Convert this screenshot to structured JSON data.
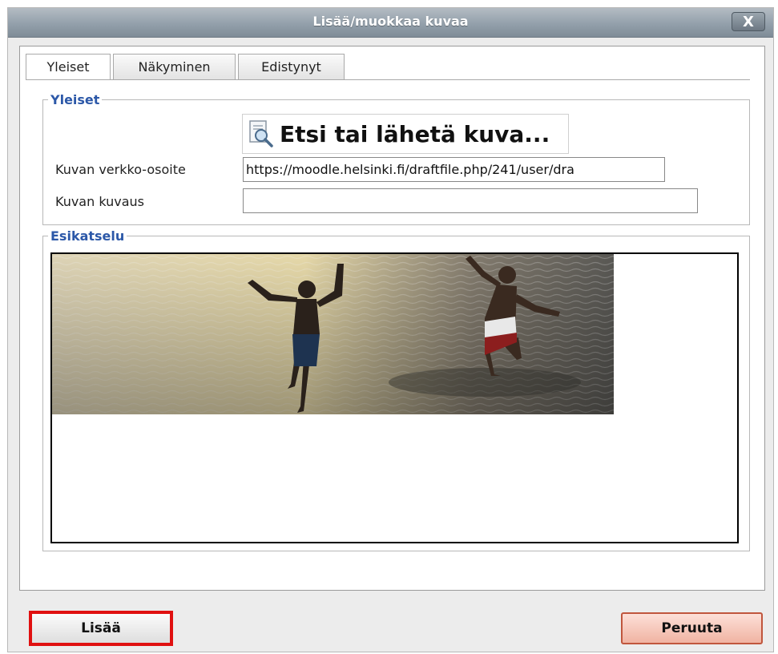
{
  "dialog": {
    "title": "Lisää/muokkaa kuvaa",
    "close_label": "X"
  },
  "tabs": [
    {
      "label": "Yleiset",
      "active": true
    },
    {
      "label": "Näkyminen",
      "active": false
    },
    {
      "label": "Edistynyt",
      "active": false
    }
  ],
  "general": {
    "legend": "Yleiset",
    "search_label": "Etsi tai lähetä kuva...",
    "search_icon": "magnifier-document-icon",
    "url_label": "Kuvan verkko-osoite",
    "url_value": "https://moodle.helsinki.fi/draftfile.php/241/user/dra",
    "description_label": "Kuvan kuvaus",
    "description_value": ""
  },
  "preview": {
    "legend": "Esikatselu"
  },
  "footer": {
    "insert_label": "Lisää",
    "cancel_label": "Peruuta"
  },
  "colors": {
    "legend_blue": "#2c58a8",
    "highlight_red": "#e01010",
    "cancel_border": "#c0563d"
  }
}
